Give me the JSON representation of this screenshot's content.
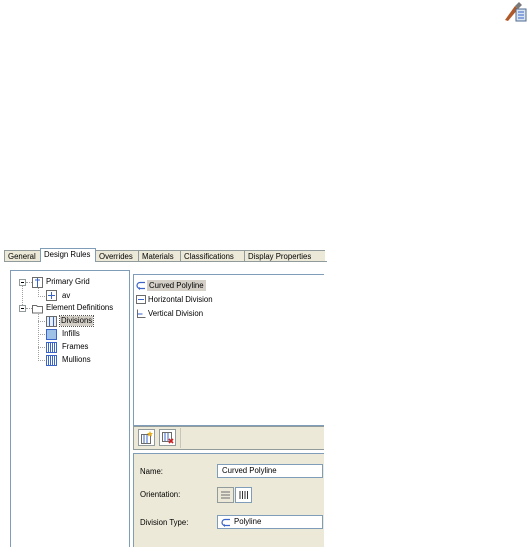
{
  "tabs": [
    {
      "label": "General",
      "active": false
    },
    {
      "label": "Design Rules",
      "active": true
    },
    {
      "label": "Overrides",
      "active": false
    },
    {
      "label": "Materials",
      "active": false
    },
    {
      "label": "Classifications",
      "active": false
    },
    {
      "label": "Display Properties",
      "active": false
    }
  ],
  "tree": {
    "primary_grid": "Primary Grid",
    "av": "av",
    "element_definitions": "Element Definitions",
    "divisions": "Divisions",
    "infills": "Infills",
    "frames": "Frames",
    "mullions": "Mullions"
  },
  "list": {
    "items": [
      {
        "label": "Curved Polyline",
        "icon": "curved-polyline-icon",
        "selected": true
      },
      {
        "label": "Horizontal Division",
        "icon": "horizontal-division-icon",
        "selected": false
      },
      {
        "label": "Vertical Division",
        "icon": "vertical-division-icon",
        "selected": false
      }
    ]
  },
  "toolbar": {
    "new_icon": "new-division-icon",
    "delete_icon": "delete-division-icon"
  },
  "properties": {
    "name_label": "Name:",
    "name_value": "Curved Polyline",
    "orientation_label": "Orientation:",
    "division_type_label": "Division Type:",
    "division_type_value": "Polyline"
  },
  "colors": {
    "tab_border": "#919b9c",
    "panel_border": "#7f9db9",
    "face": "#ece9d8",
    "selection": "#d4d0c8"
  }
}
